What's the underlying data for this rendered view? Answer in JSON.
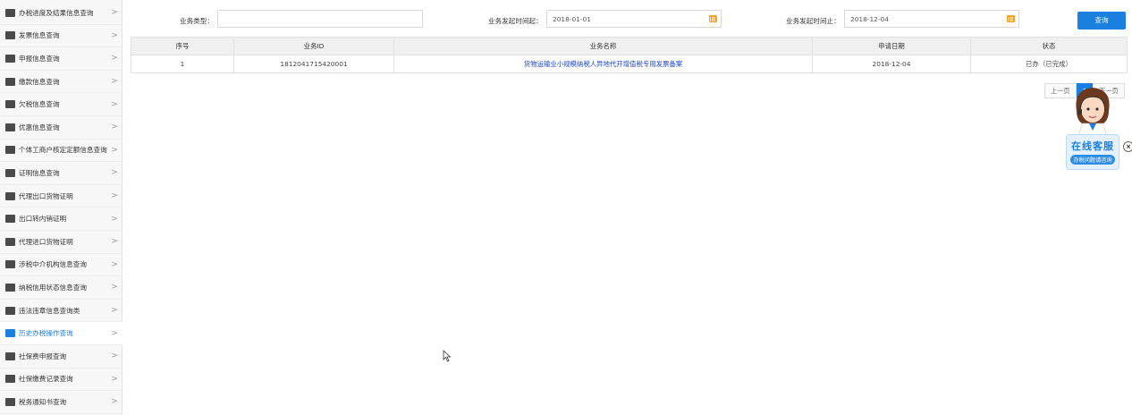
{
  "sidebar": {
    "items": [
      {
        "label": "办税进度及结果信息查询",
        "icon": "progress-doc-icon"
      },
      {
        "label": "发票信息查询",
        "icon": "invoice-icon"
      },
      {
        "label": "申报信息查询",
        "icon": "declare-icon"
      },
      {
        "label": "缴款信息查询",
        "icon": "payment-icon"
      },
      {
        "label": "欠税信息查询",
        "icon": "arrears-icon"
      },
      {
        "label": "优惠信息查询",
        "icon": "discount-icon"
      },
      {
        "label": "个体工商户核定定额信息查询",
        "icon": "business-quota-icon"
      },
      {
        "label": "证明信息查询",
        "icon": "certificate-icon"
      },
      {
        "label": "代理出口货物证明",
        "icon": "agent-export-icon"
      },
      {
        "label": "出口转内销证明",
        "icon": "export-domestic-icon"
      },
      {
        "label": "代理进口货物证明",
        "icon": "agent-import-icon"
      },
      {
        "label": "涉税中介机构信息查询",
        "icon": "agency-icon"
      },
      {
        "label": "纳税信用状态信息查询",
        "icon": "credit-icon"
      },
      {
        "label": "违法违章信息查询类",
        "icon": "violation-icon"
      },
      {
        "label": "历史办税操作查询",
        "icon": "history-icon",
        "active": true
      },
      {
        "label": "社保费申报查询",
        "icon": "social-declare-icon"
      },
      {
        "label": "社保缴费记录查询",
        "icon": "social-payment-icon"
      },
      {
        "label": "税务通知书查询",
        "icon": "notice-icon"
      }
    ],
    "chevron": ">"
  },
  "filters": {
    "type_label": "业务类型：",
    "type_value": "",
    "start_label": "业务发起时间起：",
    "start_value": "2018-01-01",
    "end_label": "业务发起时间止：",
    "end_value": "2018-12-04",
    "query_button": "查询"
  },
  "table": {
    "headers": [
      "序号",
      "业务ID",
      "业务名称",
      "申请日期",
      "状态"
    ],
    "rows": [
      [
        "1",
        "1812041715420001",
        "货物运输业小规模纳税人异地代开增值税专用发票备案",
        "2018-12-04",
        "已办（已完成）"
      ]
    ]
  },
  "pagination": {
    "prev": "上一页",
    "current": "1",
    "next": "下一页"
  },
  "customer_service": {
    "title": "在线客服",
    "subtitle": "办税问题请咨询",
    "close": "×"
  },
  "colors": {
    "accent": "#1a7fdf",
    "link": "#1a46c8",
    "calendar": "#f0a22f"
  }
}
